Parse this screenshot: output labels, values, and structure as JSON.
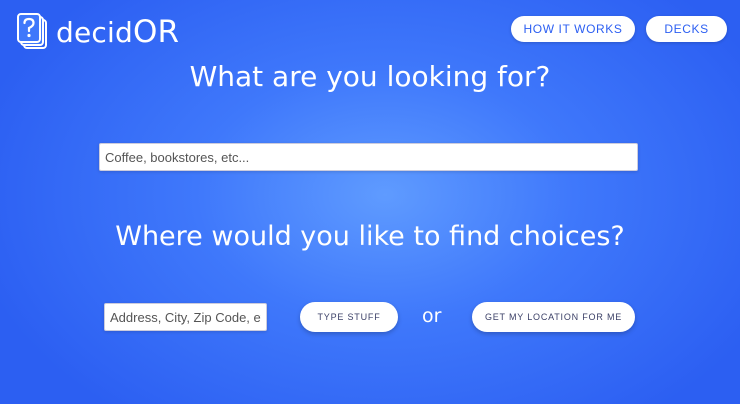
{
  "brand": {
    "name_prefix": "decid",
    "name_suffix": "OR",
    "logo_icon": "question-cards-icon"
  },
  "nav": {
    "how_it_works": "HOW IT WORKS",
    "decks": "DECKS"
  },
  "search": {
    "heading": "What are you looking for?",
    "placeholder": "Coffee, bookstores, etc..."
  },
  "location": {
    "heading": "Where would you like to find choices?",
    "placeholder": "Address, City, Zip Code, etc.",
    "type_button": "TYPE STUFF",
    "or_label": "or",
    "geo_button": "GET MY LOCATION FOR ME"
  },
  "colors": {
    "background": "#3f78fb",
    "background_center": "#5f9bff",
    "button_text": "#2c5ff2",
    "white": "#ffffff"
  }
}
